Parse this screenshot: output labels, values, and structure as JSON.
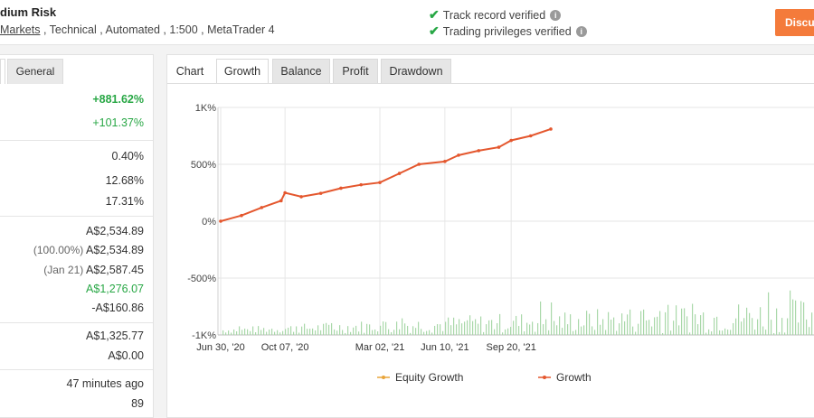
{
  "header": {
    "title": "dium Risk",
    "meta_link": "Markets",
    "meta_rest": ", Technical , Automated , 1:500 , MetaTrader 4",
    "verify_track": "Track record verified",
    "verify_trading": "Trading privileges verified",
    "discuss_label": "Discus",
    "accent": "#f47b3b",
    "check_color": "#27a745"
  },
  "stats": {
    "tab_general": "General",
    "rows": {
      "gain": "+881.62%",
      "abs_gain": "+101.37%",
      "daily": "0.40%",
      "monthly": "12.68%",
      "drawdown": "17.31%",
      "balance": "A$2,534.89",
      "equity_pct": "(100.00%)",
      "equity": "A$2,534.89",
      "highest_date": "(Jan 21)",
      "highest": "A$2,587.45",
      "profit": "A$1,276.07",
      "interest": "-A$160.86",
      "deposits": "A$1,325.77",
      "withdrawals": "A$0.00",
      "updated": "47 minutes ago",
      "tracking": "89"
    }
  },
  "tabs": [
    "Chart",
    "Growth",
    "Balance",
    "Profit",
    "Drawdown"
  ],
  "active_tab": "Growth",
  "chart_data": {
    "type": "line",
    "y_tick_labels": [
      "1K%",
      "500%",
      "0%",
      "-500%",
      "-1K%"
    ],
    "ylim": [
      -1000,
      1000
    ],
    "x_tick_labels": [
      "Jun 30, '20",
      "Oct 07, '20",
      "Mar 02, '21",
      "Jun 10, '21",
      "Sep 20, '21"
    ],
    "x": [
      "2020-06-30",
      "2020-08-01",
      "2020-09-01",
      "2020-10-01",
      "2020-10-07",
      "2020-11-01",
      "2020-12-01",
      "2021-01-01",
      "2021-02-01",
      "2021-03-02",
      "2021-04-01",
      "2021-05-01",
      "2021-06-10",
      "2021-07-01",
      "2021-08-01",
      "2021-09-01",
      "2021-09-20",
      "2021-10-20",
      "2021-11-20"
    ],
    "series": [
      {
        "name": "Growth",
        "color": "#e4572e",
        "values": [
          0,
          50,
          120,
          180,
          250,
          215,
          245,
          290,
          320,
          340,
          420,
          500,
          525,
          580,
          620,
          650,
          710,
          750,
          810
        ]
      },
      {
        "name": "Equity Growth",
        "color": "#e9a53a",
        "values": []
      }
    ],
    "bar_color": "#a9d8a9",
    "grid": true,
    "legend_position": "bottom"
  }
}
